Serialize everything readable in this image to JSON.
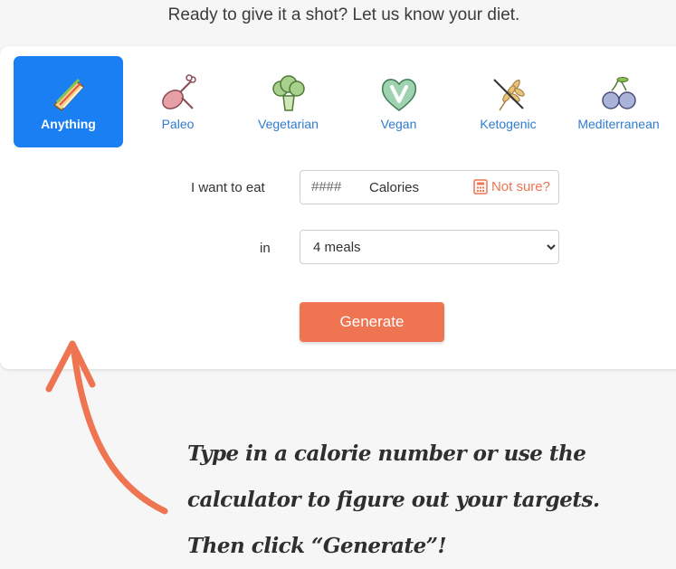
{
  "heading": "Ready to give it a shot? Let us know your diet.",
  "diets": [
    {
      "label": "Anything",
      "icon": "sandwich-icon",
      "active": true
    },
    {
      "label": "Paleo",
      "icon": "meat-drumstick-icon",
      "active": false
    },
    {
      "label": "Vegetarian",
      "icon": "broccoli-icon",
      "active": false
    },
    {
      "label": "Vegan",
      "icon": "vegan-heart-icon",
      "active": false
    },
    {
      "label": "Ketogenic",
      "icon": "no-wheat-icon",
      "active": false
    },
    {
      "label": "Mediterranean",
      "icon": "olives-icon",
      "active": false
    }
  ],
  "form": {
    "calories_label": "I want to eat",
    "calories_placeholder": "####",
    "calories_value": "",
    "calories_unit": "Calories",
    "not_sure_label": "Not sure?",
    "meals_label": "in",
    "meals_selected": "4 meals",
    "generate_label": "Generate"
  },
  "hint": {
    "lines": [
      "Type in a calorie number or use the",
      "calculator to figure out your targets.",
      "Then click “Generate”!"
    ]
  },
  "colors": {
    "accent_blue": "#1a7ff3",
    "accent_orange": "#ef7451",
    "link_blue": "#2e7bcf"
  }
}
